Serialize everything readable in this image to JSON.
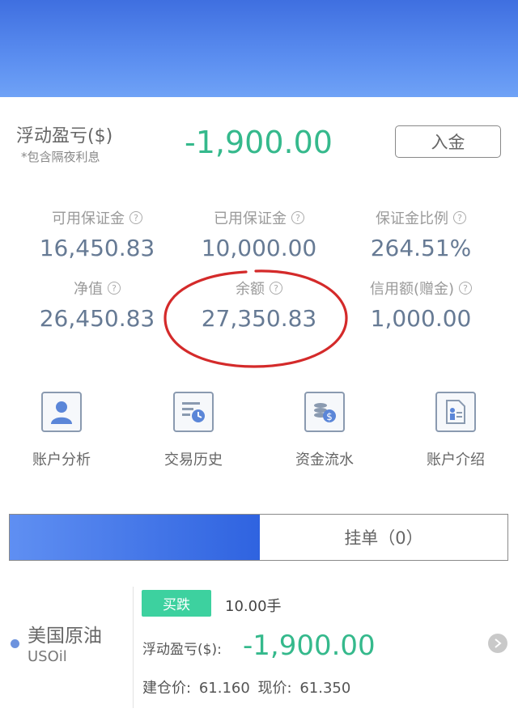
{
  "summary": {
    "floating_pl_label": "浮动盈亏($)",
    "floating_pl_note": "*包含隔夜利息",
    "floating_pl_value": "-1,900.00",
    "deposit_label": "入金"
  },
  "stats": [
    {
      "label": "可用保证金",
      "value": "16,450.83"
    },
    {
      "label": "已用保证金",
      "value": "10,000.00"
    },
    {
      "label": "保证金比例",
      "value": "264.51%"
    },
    {
      "label": "净值",
      "value": "26,450.83"
    },
    {
      "label": "余额",
      "value": "27,350.83"
    },
    {
      "label": "信用额(赠金)",
      "value": "1,000.00"
    }
  ],
  "help_glyph": "?",
  "actions": [
    {
      "label": "账户分析",
      "icon": "user-icon"
    },
    {
      "label": "交易历史",
      "icon": "history-clock-icon"
    },
    {
      "label": "资金流水",
      "icon": "coins-dollar-icon"
    },
    {
      "label": "账户介绍",
      "icon": "account-doc-icon"
    }
  ],
  "tabs": {
    "active_label": "",
    "pending_label": "挂单（0）"
  },
  "position": {
    "name": "美国原油",
    "code": "USOil",
    "side": "买跌",
    "lots": "10.00手",
    "pl_label": "浮动盈亏($):",
    "pl_value": "-1,900.00",
    "open_price_label": "建仓价:",
    "open_price": "61.160",
    "current_price_label": "现价:",
    "current_price": "61.350"
  },
  "colors": {
    "header_blue": "#3f6fe0",
    "profit_green": "#35b98c",
    "badge_green": "#3dd19f",
    "annotation_red": "#d42a2a"
  }
}
